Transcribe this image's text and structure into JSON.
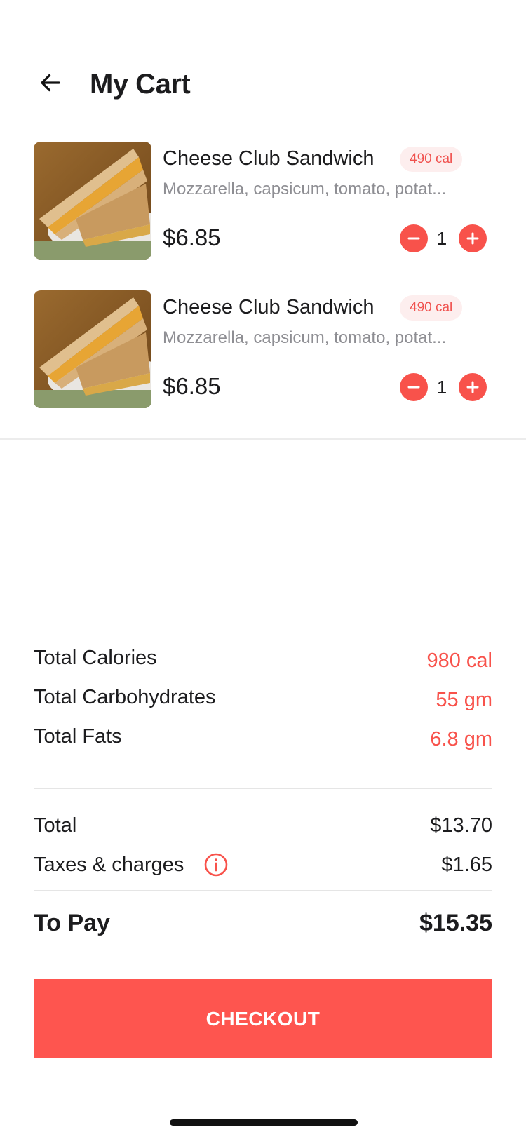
{
  "header": {
    "title": "My Cart",
    "back_icon": "arrow-left-icon"
  },
  "cart": {
    "items": [
      {
        "name": "Cheese Club Sandwich",
        "calories": "490 cal",
        "description": "Mozzarella, capsicum, tomato, potat...",
        "price": "$6.85",
        "quantity": "1",
        "image": "sandwich-photo"
      },
      {
        "name": "Cheese Club Sandwich",
        "calories": "490 cal",
        "description": "Mozzarella, capsicum, tomato, potat...",
        "price": "$6.85",
        "quantity": "1",
        "image": "sandwich-photo"
      }
    ]
  },
  "nutrition": {
    "calories_label": "Total Calories",
    "calories_value": "980 cal",
    "carbs_label": "Total Carbohydrates",
    "carbs_value": "55 gm",
    "fats_label": "Total Fats",
    "fats_value": "6.8 gm"
  },
  "billing": {
    "total_label": "Total",
    "total_value": "$13.70",
    "taxes_label": "Taxes & charges",
    "taxes_value": "$1.65",
    "to_pay_label": "To Pay",
    "to_pay_value": "$15.35"
  },
  "checkout": {
    "label": "CHECKOUT"
  },
  "colors": {
    "accent": "#f8524b",
    "badge_bg": "#fdeeee",
    "muted_text": "#8e8e93"
  }
}
